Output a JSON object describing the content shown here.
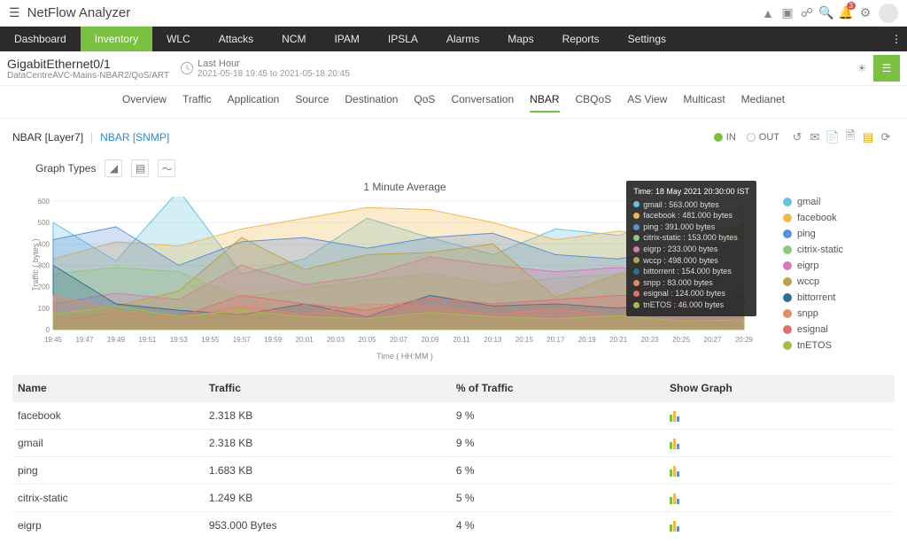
{
  "brand": "NetFlow Analyzer",
  "topIcons": {
    "notificationsBadge": "3"
  },
  "nav": [
    "Dashboard",
    "Inventory",
    "WLC",
    "Attacks",
    "NCM",
    "IPAM",
    "IPSLA",
    "Alarms",
    "Maps",
    "Reports",
    "Settings"
  ],
  "navActive": "Inventory",
  "context": {
    "iface": "GigabitEthernet0/1",
    "path": "DataCentreAVC-Mains-NBAR2/QoS/ART",
    "period": "Last Hour",
    "range": "2021-05-18 19:45 to 2021-05-18 20:45"
  },
  "subtabs": [
    "Overview",
    "Traffic",
    "Application",
    "Source",
    "Destination",
    "QoS",
    "Conversation",
    "NBAR",
    "CBQoS",
    "AS View",
    "Multicast",
    "Medianet"
  ],
  "subActive": "NBAR",
  "nbarTabs": {
    "a": "NBAR [Layer7]",
    "b": "NBAR [SNMP]"
  },
  "ioToggle": {
    "in": "IN",
    "out": "OUT"
  },
  "graphTypesLabel": "Graph Types",
  "chart_data": {
    "type": "area",
    "title": "1 Minute Average",
    "xlabel": "Time ( HH:MM )",
    "ylabel": "Traffic ( bytes )",
    "ylim": [
      0,
      600
    ],
    "xticks": [
      "19:45",
      "19:47",
      "19:49",
      "19:51",
      "19:53",
      "19:55",
      "19:57",
      "19:59",
      "20:01",
      "20:03",
      "20:05",
      "20:07",
      "20:09",
      "20:11",
      "20:13",
      "20:15",
      "20:17",
      "20:19",
      "20:21",
      "20:23",
      "20:25",
      "20:27",
      "20:29"
    ],
    "categories": [
      "19:51",
      "19:55",
      "19:59",
      "20:03",
      "20:07",
      "20:09",
      "20:11",
      "20:15",
      "20:19",
      "20:23",
      "20:27",
      "20:30"
    ],
    "series": [
      {
        "name": "gmail",
        "color": "#66c2e0",
        "values": [
          500,
          320,
          650,
          260,
          330,
          520,
          430,
          350,
          470,
          440,
          530,
          563
        ]
      },
      {
        "name": "facebook",
        "color": "#f2b84b",
        "values": [
          330,
          410,
          390,
          470,
          520,
          570,
          560,
          500,
          420,
          460,
          440,
          481
        ]
      },
      {
        "name": "ping",
        "color": "#5b8fd6",
        "values": [
          420,
          480,
          300,
          410,
          430,
          380,
          430,
          450,
          350,
          330,
          380,
          391
        ]
      },
      {
        "name": "citrix-static",
        "color": "#8fc97d",
        "values": [
          260,
          290,
          270,
          150,
          190,
          230,
          260,
          210,
          240,
          260,
          200,
          153
        ]
      },
      {
        "name": "eigrp",
        "color": "#d879b7",
        "values": [
          120,
          170,
          140,
          300,
          210,
          250,
          340,
          300,
          270,
          290,
          260,
          233
        ]
      },
      {
        "name": "wccp",
        "color": "#bca24a",
        "values": [
          70,
          110,
          180,
          430,
          280,
          350,
          360,
          400,
          150,
          260,
          330,
          498
        ]
      },
      {
        "name": "bittorrent",
        "color": "#2f6f8f",
        "values": [
          300,
          120,
          90,
          70,
          120,
          60,
          160,
          110,
          120,
          100,
          130,
          154
        ]
      },
      {
        "name": "snpp",
        "color": "#e28b66",
        "values": [
          160,
          90,
          50,
          110,
          70,
          120,
          110,
          70,
          95,
          60,
          100,
          83
        ]
      },
      {
        "name": "esignal",
        "color": "#e06f6f",
        "values": [
          40,
          80,
          60,
          160,
          120,
          90,
          150,
          120,
          140,
          160,
          150,
          124
        ]
      },
      {
        "name": "tnETOS",
        "color": "#a6bc4f",
        "values": [
          70,
          110,
          60,
          90,
          60,
          50,
          80,
          60,
          50,
          65,
          40,
          46
        ]
      }
    ]
  },
  "tooltip": {
    "header": "Time: 18 May 2021 20:30:00 IST",
    "rows": [
      {
        "c": "#66c2e0",
        "t": "gmail : 563.000 bytes"
      },
      {
        "c": "#f2b84b",
        "t": "facebook : 481.000 bytes"
      },
      {
        "c": "#5b8fd6",
        "t": "ping : 391.000 bytes"
      },
      {
        "c": "#8fc97d",
        "t": "citrix-static : 153.000 bytes"
      },
      {
        "c": "#d879b7",
        "t": "eigrp : 233.000 bytes"
      },
      {
        "c": "#bca24a",
        "t": "wccp : 498.000 bytes"
      },
      {
        "c": "#2f6f8f",
        "t": "bittorrent : 154.000 bytes"
      },
      {
        "c": "#e28b66",
        "t": "snpp : 83.000 bytes"
      },
      {
        "c": "#e06f6f",
        "t": "esignal : 124.000 bytes"
      },
      {
        "c": "#a6bc4f",
        "t": "tnETOS : 46.000 bytes"
      }
    ]
  },
  "table": {
    "headers": [
      "Name",
      "Traffic",
      "% of Traffic",
      "Show Graph"
    ],
    "rows": [
      {
        "name": "facebook",
        "traffic": "2.318 KB",
        "pct": "9 %"
      },
      {
        "name": "gmail",
        "traffic": "2.318 KB",
        "pct": "9 %"
      },
      {
        "name": "ping",
        "traffic": "1.683 KB",
        "pct": "6 %"
      },
      {
        "name": "citrix-static",
        "traffic": "1.249 KB",
        "pct": "5 %"
      },
      {
        "name": "eigrp",
        "traffic": "953.000 Bytes",
        "pct": "4 %"
      }
    ]
  }
}
